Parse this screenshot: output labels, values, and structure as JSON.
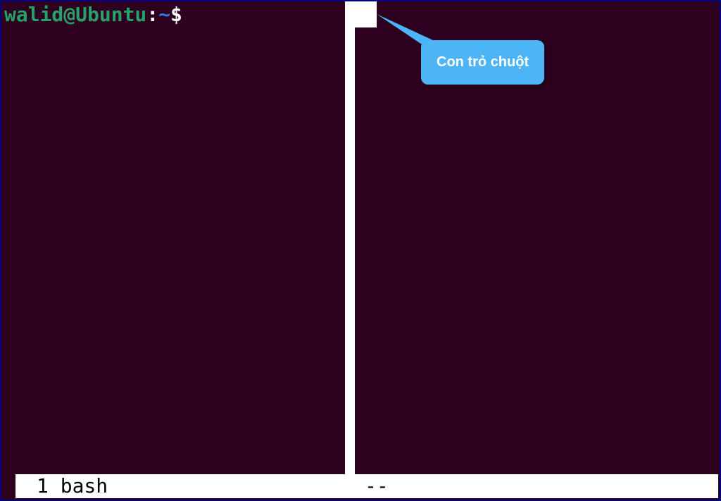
{
  "prompt": {
    "user_host": "walid@Ubuntu",
    "colon": ":",
    "path": "~",
    "dollar": "$"
  },
  "status": {
    "window_number": "1",
    "process": "bash",
    "indicator": "--"
  },
  "callout": {
    "text": "Con trỏ chuột"
  },
  "colors": {
    "background": "#2c001e",
    "prompt_user": "#26a269",
    "prompt_path": "#2a7bde",
    "prompt_text": "#ffffff",
    "divider": "#ffffff",
    "callout_bg": "#4db5f5",
    "callout_text": "#ffffff"
  }
}
